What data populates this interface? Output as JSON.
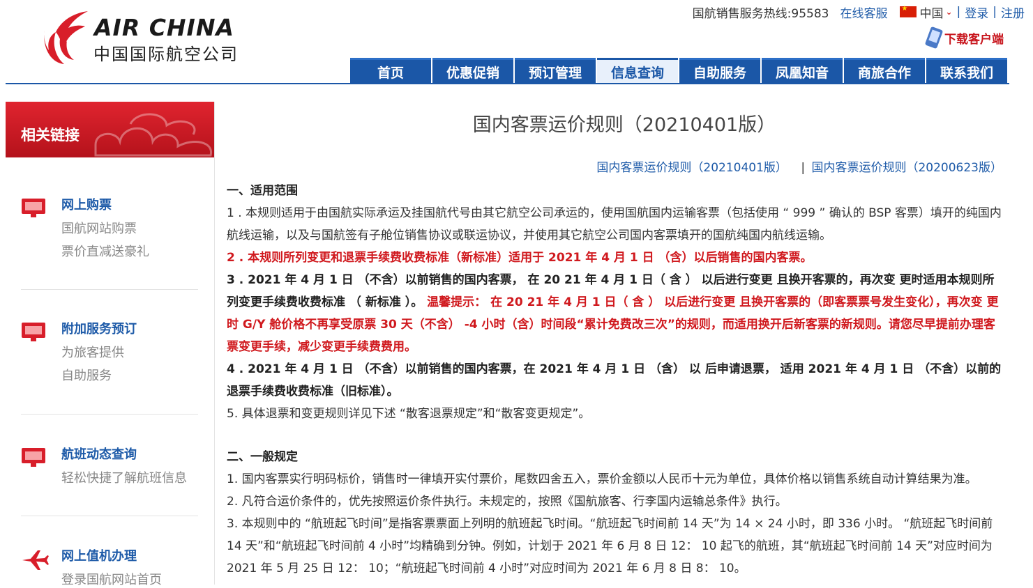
{
  "header": {
    "logo_en": "AIR CHINA",
    "logo_cn": "中国国际航空公司",
    "hotline": "国航销售服务热线:95583",
    "online_service": "在线客服",
    "country": "中国",
    "login": "登录",
    "register": "注册",
    "download_client": "下载客户端",
    "sep": "|"
  },
  "nav": [
    {
      "label": "首页"
    },
    {
      "label": "优惠促销"
    },
    {
      "label": "预订管理"
    },
    {
      "label": "信息查询"
    },
    {
      "label": "自助服务"
    },
    {
      "label": "凤凰知音"
    },
    {
      "label": "商旅合作"
    },
    {
      "label": "联系我们"
    }
  ],
  "sidebar": {
    "title": "相关链接",
    "items": [
      {
        "name": "网上购票",
        "subs": [
          "国航网站购票",
          "票价直减送豪礼"
        ]
      },
      {
        "name": "附加服务预订",
        "subs": [
          "为旅客提供",
          "自助服务"
        ]
      },
      {
        "name": "航班动态查询",
        "subs": [
          "轻松快捷了解航班信息"
        ]
      },
      {
        "name": "网上值机办理",
        "subs": [
          "登录国航网站首页"
        ]
      }
    ]
  },
  "main": {
    "title": "国内客票运价规则（20210401版）",
    "version_links": [
      "国内客票运价规则（20210401版）",
      "国内客票运价规则（20200623版）"
    ],
    "version_sep": "|",
    "section1": {
      "heading": "一、适用范围",
      "p1": "1 . 本规则适用于由国航实际承运及挂国航代号由其它航空公司承运的，使用国航国内运输客票（包括使用 “ 999 ” 确认的 BSP 客票）填开的纯国内航线运输，以及与国航签有子舱位销售协议或联运协议，并使用其它航空公司国内客票填开的国航纯国内航线运输。",
      "p2": "2 . 本规则所列变更和退票手续费收费标准（新标准）适用于 2021 年 4 月 1 日 （含）以后销售的国内客票。",
      "p3_bold": "3 . 2021 年 4 月 1 日 （不含）以前销售的国内客票， 在 20 21 年 4 月 1 日（ 含 ） 以后进行变更 且换开客票的，再次变 更时适用本规则所列变更手续费收费标准 （ 新标准 ）。",
      "p3_red": " 温馨提示： 在 20 21 年 4 月 1 日（ 含 ） 以后进行变更 且换开客票的（即客票票号发生变化），再次变 更时 G/Y 舱价格不再享受原票 30 天（不含） -4 小时（含）时间段“累计免费改三次”的规则，而适用换开后新客票的新规则。请您尽早提前办理客票变更手续，减少变更手续费费用。",
      "p4": "4 . 2021 年 4 月 1 日 （不含）以前销售的国内客票，在 2021 年 4 月 1 日 （含） 以 后申请退票， 适用 2021 年 4 月 1 日 （不含）以前的退票手续费收费标准（旧标准）。",
      "p5": "5. 具体退票和变更规则详见下述 “散客退票规定”和“散客变更规定”。"
    },
    "section2": {
      "heading": "二、一般规定",
      "p1": "1. 国内客票实行明码标价，销售时一律填开实付票价，尾数四舍五入，票价金额以人民币十元为单位，具体价格以销售系统自动计算结果为准。",
      "p2": "2. 凡符合运价条件的，优先按照运价条件执行。未规定的，按照《国航旅客、行李国内运输总条件》执行。",
      "p3": "3. 本规则中的 “航班起飞时间”是指客票票面上列明的航班起飞时间。“航班起飞时间前 14 天”为 14 × 24 小时，即 336 小时。 “航班起飞时间前 14 天”和“航班起飞时间前 4 小时”均精确到分钟。例如，计划于 2021 年 6 月 8 日 12： 10 起飞的航班，其“航班起飞时间前 14 天”对应时间为 2021 年 5 月 25 日 12： 10；“航班起飞时间前 4 小时”对应时间为 2021 年 6 月 8 日 8： 10。"
    }
  }
}
